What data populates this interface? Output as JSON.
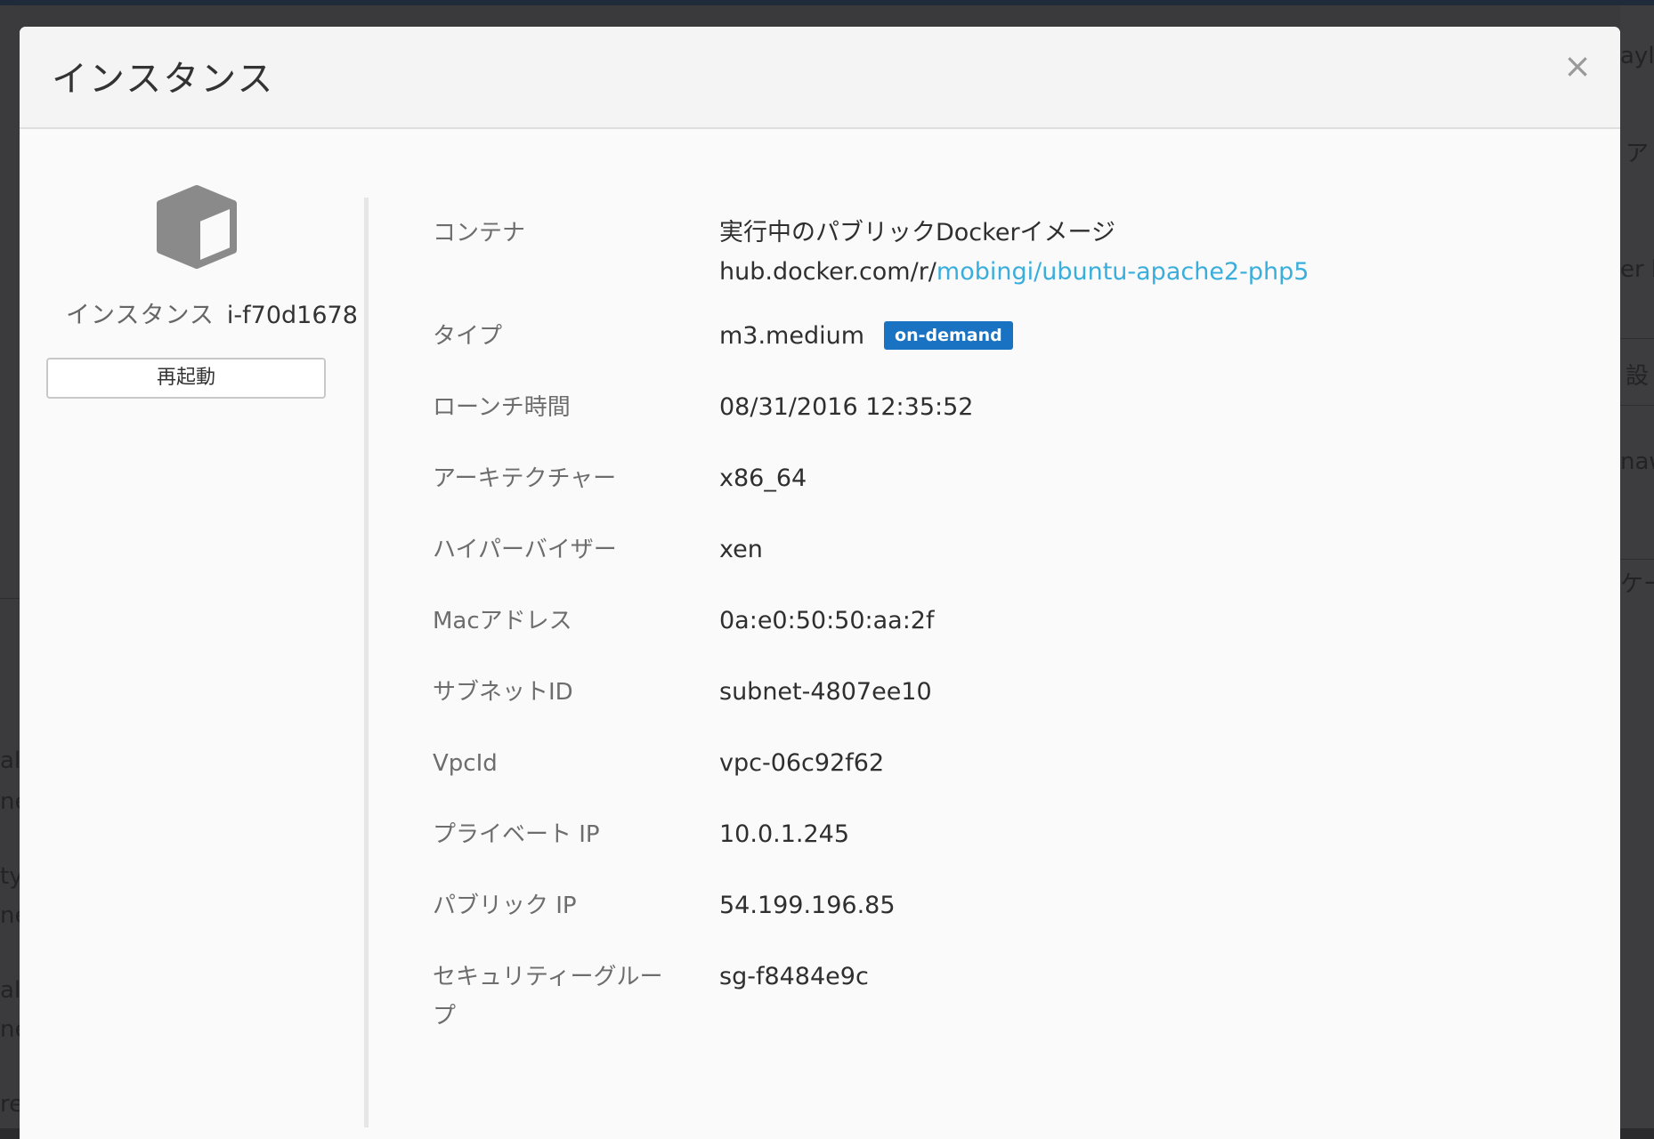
{
  "modal": {
    "title": "インスタンス",
    "close_label": "×"
  },
  "instance": {
    "icon": "cube-icon",
    "label": "インスタンス",
    "id": "i-f70d1678",
    "restart_label": "再起動"
  },
  "details": {
    "container": {
      "label": "コンテナ",
      "line1": "実行中のパブリックDockerイメージ",
      "prefix": "hub.docker.com/r/",
      "link": "mobingi/ubuntu-apache2-php5"
    },
    "type": {
      "label": "タイプ",
      "value": "m3.medium",
      "badge": "on-demand"
    },
    "launch_time": {
      "label": "ローンチ時間",
      "value": "08/31/2016 12:35:52"
    },
    "architecture": {
      "label": "アーキテクチャー",
      "value": "x86_64"
    },
    "hypervisor": {
      "label": "ハイパーバイザー",
      "value": "xen"
    },
    "mac": {
      "label": "Macアドレス",
      "value": "0a:e0:50:50:aa:2f"
    },
    "subnet": {
      "label": "サブネットID",
      "value": "subnet-4807ee10"
    },
    "vpc": {
      "label": "VpcId",
      "value": "vpc-06c92f62"
    },
    "private_ip": {
      "label": "プライベート IP",
      "value": "10.0.1.245"
    },
    "public_ip": {
      "label": "パブリック IP",
      "value": "54.199.196.85"
    },
    "security_group": {
      "label_line1": "セキュリティーグルー",
      "label_line2": "プ",
      "value": "sg-f8484e9c"
    }
  },
  "background": {
    "fragments": [
      "ayl",
      "ア",
      "er b",
      "設",
      "naw",
      "ケー",
      "ali",
      "ne",
      "ty",
      "ne",
      "ali",
      "ne",
      "re"
    ]
  },
  "colors": {
    "link": "#3aaedb",
    "badge": "#1a73c2",
    "overlay": "#3a3a3c"
  }
}
